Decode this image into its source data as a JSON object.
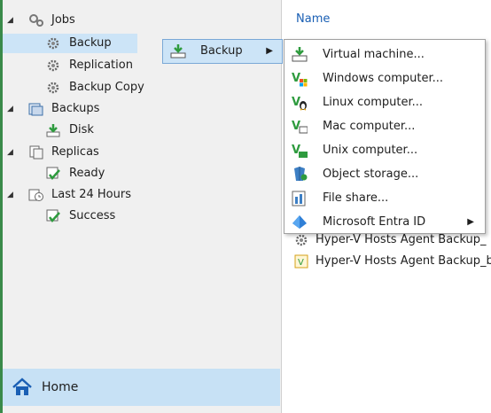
{
  "tree": {
    "jobs": "Jobs",
    "backup": "Backup",
    "replication": "Replication",
    "backup_copy": "Backup Copy",
    "backups": "Backups",
    "disk": "Disk",
    "replicas": "Replicas",
    "ready": "Ready",
    "last24": "Last 24 Hours",
    "success": "Success"
  },
  "home": {
    "label": "Home"
  },
  "list": {
    "column_name": "Name",
    "rows": [
      "Hyper-V Hosts Agent Backup_",
      "Hyper-V Hosts Agent Backup_b"
    ]
  },
  "submenu": {
    "label": "Backup"
  },
  "menu": {
    "items": [
      {
        "label": "Virtual machine...",
        "icon": "vm-backup-icon"
      },
      {
        "label": "Windows computer...",
        "icon": "windows-icon"
      },
      {
        "label": "Linux computer...",
        "icon": "linux-icon"
      },
      {
        "label": "Mac computer...",
        "icon": "mac-icon"
      },
      {
        "label": "Unix computer...",
        "icon": "unix-icon"
      },
      {
        "label": "Object storage...",
        "icon": "object-storage-icon"
      },
      {
        "label": "File share...",
        "icon": "file-share-icon"
      },
      {
        "label": "Microsoft Entra ID",
        "icon": "entra-id-icon"
      }
    ]
  },
  "colors": {
    "selection": "#cce4f7",
    "accent_green": "#2e9b3e",
    "link_blue": "#1a5fb4"
  }
}
